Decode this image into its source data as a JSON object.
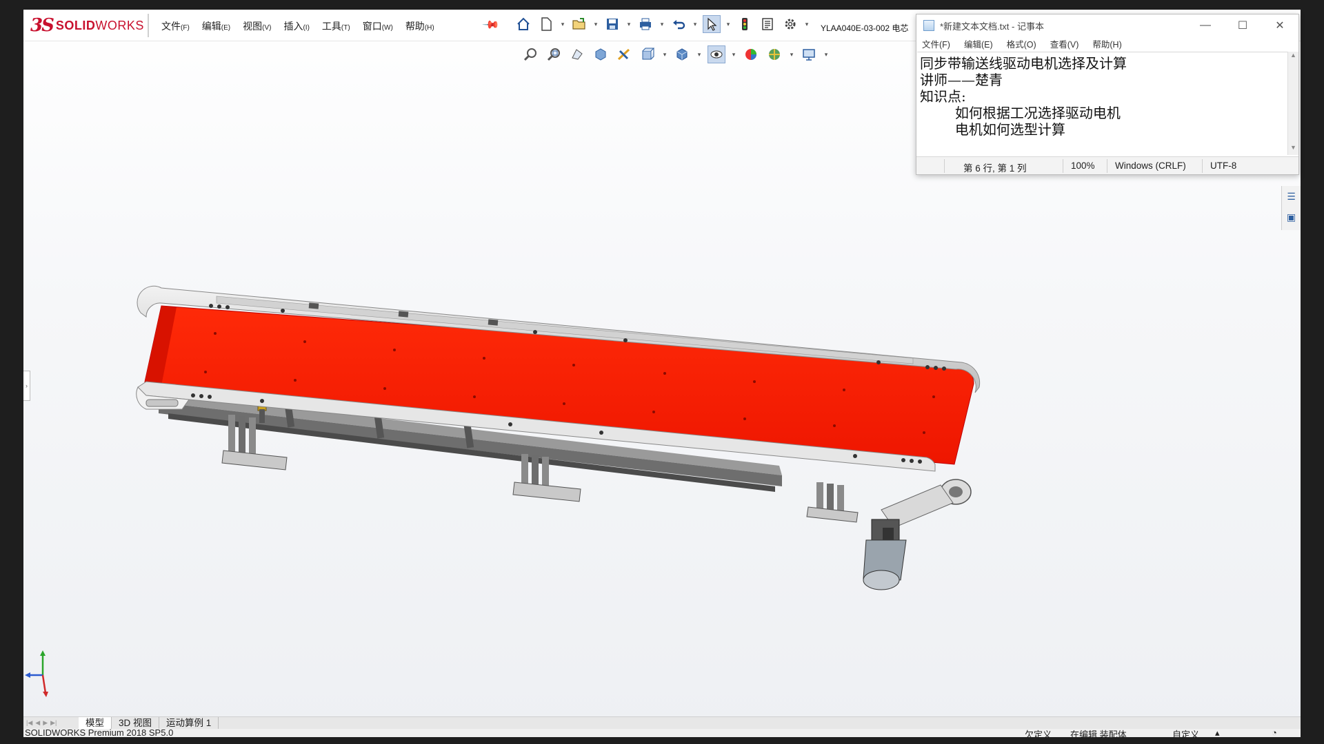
{
  "app": {
    "logo_prefix": "3S",
    "logo_name_bold": "SOLID",
    "logo_name_light": "WORKS",
    "document_title": "YLAA040E-03-002 电芯"
  },
  "menu": [
    {
      "label": "文件",
      "key": "(F)"
    },
    {
      "label": "编辑",
      "key": "(E)"
    },
    {
      "label": "视图",
      "key": "(V)"
    },
    {
      "label": "插入",
      "key": "(I)"
    },
    {
      "label": "工具",
      "key": "(T)"
    },
    {
      "label": "窗口",
      "key": "(W)"
    },
    {
      "label": "帮助",
      "key": "(H)"
    }
  ],
  "toolbar_icons": [
    "home-icon",
    "new-document-icon",
    "open-icon",
    "save-icon",
    "print-icon",
    "undo-icon",
    "select-icon",
    "traffic-light-icon",
    "file-properties-icon",
    "options-gear-icon"
  ],
  "view_toolbar_icons": [
    "zoom-to-fit-icon",
    "zoom-area-icon",
    "previous-view-icon",
    "section-view-icon",
    "dynamic-annotation-icon",
    "view-orientation-icon",
    "display-style-icon",
    "hide-show-items-icon",
    "edit-appearance-icon",
    "apply-scene-icon",
    "view-settings-icon"
  ],
  "notepad": {
    "title": "*新建文本文档.txt - 记事本",
    "menu": [
      "文件(F)",
      "编辑(E)",
      "格式(O)",
      "查看(V)",
      "帮助(H)"
    ],
    "lines": [
      "同步带输送线驱动电机选择及计算",
      "讲师——楚青",
      "知识点:",
      "        如何根据工况选择驱动电机",
      "        电机如何选型计算"
    ],
    "status": {
      "position": "第 6 行, 第 1 列",
      "zoom": "100%",
      "line_ending": "Windows (CRLF)",
      "encoding": "UTF-8"
    }
  },
  "colors": {
    "belt": "#ff1a00",
    "frame": "#d9d9d9",
    "logo": "#c8102e"
  },
  "tabs": [
    "模型",
    "3D 视图",
    "运动算例 1"
  ],
  "status": {
    "product": "SOLIDWORKS Premium 2018 SP5.0",
    "definition": "欠定义",
    "mode": "在编辑 装配体",
    "units": "自定义"
  }
}
